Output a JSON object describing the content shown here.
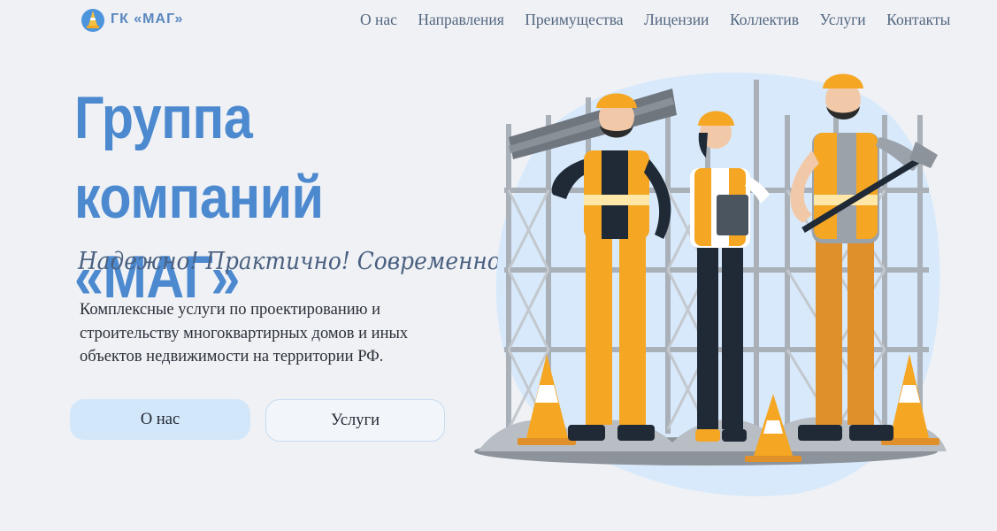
{
  "header": {
    "logo_text": "ГК «МАГ»",
    "nav": [
      "О нас",
      "Направления",
      "Преимущества",
      "Лицензии",
      "Коллектив",
      "Услуги",
      "Контакты"
    ]
  },
  "hero": {
    "title_line1": "Группа компаний",
    "title_line2": "«МАГ»",
    "tagline": "Надежно! Практично! Современно!",
    "description": "Комплексные услуги по проектированию и строительству многоквартирных домов и иных объектов недвижимости на территории РФ.",
    "buttons": {
      "about": "О нас",
      "services": "Услуги"
    }
  },
  "colors": {
    "accent": "#4c89cf",
    "background": "#eff1f5",
    "button_fill": "#d3e7fb",
    "vest": "#f5a623"
  },
  "icons": {
    "logo": "traffic-cone-icon",
    "illustration": "construction-workers-illustration"
  }
}
